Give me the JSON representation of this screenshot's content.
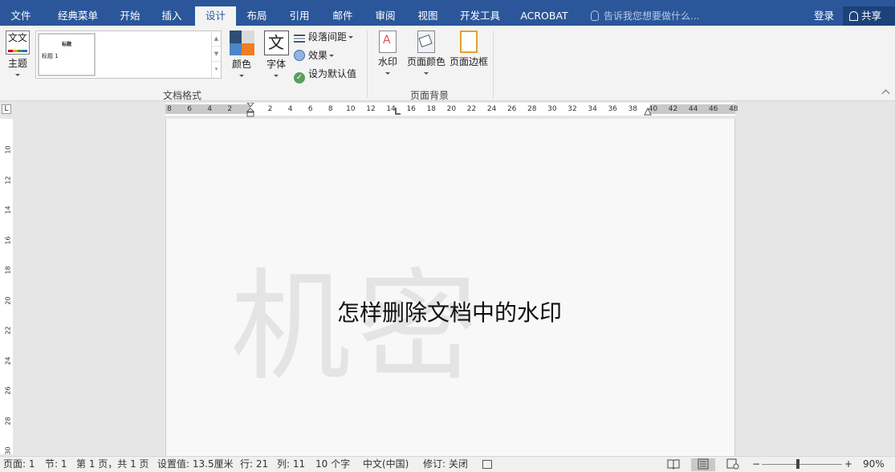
{
  "tabs": [
    {
      "label": "文件"
    },
    {
      "label": "经典菜单"
    },
    {
      "label": "开始"
    },
    {
      "label": "插入"
    },
    {
      "label": "设计"
    },
    {
      "label": "布局"
    },
    {
      "label": "引用"
    },
    {
      "label": "邮件"
    },
    {
      "label": "审阅"
    },
    {
      "label": "视图"
    },
    {
      "label": "开发工具"
    },
    {
      "label": "ACROBAT"
    }
  ],
  "tellme": {
    "placeholder": "告诉我您想要做什么..."
  },
  "account": {
    "login": "登录",
    "share": "共享"
  },
  "ribbon": {
    "theme": {
      "label": "主题",
      "icon": "theme-icon",
      "icon_text": "文文"
    },
    "gallery": {
      "title_text": "标题",
      "heading_text": "标题 1"
    },
    "colors": {
      "label": "颜色",
      "swatches": [
        "#2f4d75",
        "#d9d9d9",
        "#4a86c8",
        "#f07d22"
      ]
    },
    "fonts": {
      "label": "字体",
      "icon_text": "文"
    },
    "paragraph_spacing": {
      "label": "段落间距"
    },
    "effects": {
      "label": "效果"
    },
    "set_default": {
      "label": "设为默认值"
    },
    "doc_format_group": "文档格式",
    "watermark": {
      "label": "水印"
    },
    "page_color": {
      "label": "页面颜色"
    },
    "page_borders": {
      "label": "页面边框"
    },
    "page_background_group": "页面背景"
  },
  "ruler": {
    "corner": "L",
    "ticks": [
      "8",
      "6",
      "4",
      "2",
      "",
      "2",
      "4",
      "6",
      "8",
      "10",
      "12",
      "14",
      "16",
      "18",
      "20",
      "22",
      "24",
      "26",
      "28",
      "30",
      "32",
      "34",
      "36",
      "38",
      "40",
      "42",
      "44",
      "46",
      "48"
    ],
    "vticks": [
      "10",
      "12",
      "14",
      "16",
      "18",
      "20",
      "22",
      "24",
      "26",
      "28",
      "30"
    ]
  },
  "document": {
    "watermark_text": "机密",
    "body_text": "怎样删除文档中的水印"
  },
  "status": {
    "page": "页面: 1",
    "section": "节: 1",
    "page_of": "第 1 页，共 1 页",
    "position": "设置值: 13.5厘米",
    "line": "行: 21",
    "column": "列: 11",
    "words": "10 个字",
    "language": "中文(中国)",
    "track_changes": "修订: 关闭",
    "zoom_minus": "−",
    "zoom_plus": "+",
    "zoom": "90%"
  },
  "accent": "#2b579a"
}
